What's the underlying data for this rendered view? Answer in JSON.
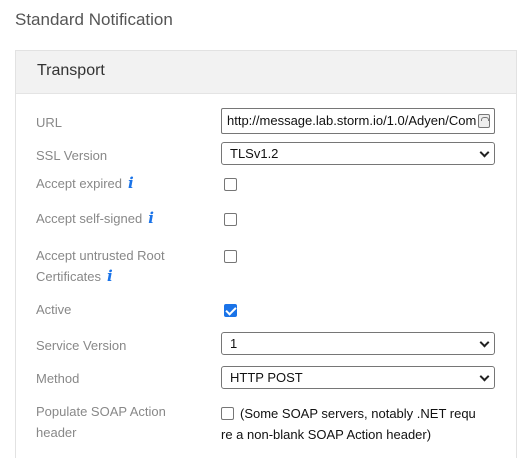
{
  "page_title": "Standard Notification",
  "panel": {
    "title": "Transport"
  },
  "fields": {
    "url": {
      "label": "URL",
      "value": "http://message.lab.storm.io/1.0/Adyen/Com"
    },
    "ssl_version": {
      "label": "SSL Version",
      "value": "TLSv1.2"
    },
    "accept_expired": {
      "label": "Accept expired",
      "checked": false
    },
    "accept_self_signed": {
      "label": "Accept self-signed",
      "checked": false
    },
    "accept_untrusted_root": {
      "label_line1": "Accept untrusted Root",
      "label_line2": "Certificates",
      "checked": false
    },
    "active": {
      "label": "Active",
      "checked": true
    },
    "service_version": {
      "label": "Service Version",
      "value": "1"
    },
    "method": {
      "label": "Method",
      "value": "HTTP POST"
    },
    "populate_soap": {
      "label_line1": "Populate SOAP Action",
      "label_line2": "header",
      "checked": false,
      "note_line1": "(Some SOAP servers, notably .NET requ",
      "note_line2": "re a non-blank SOAP Action header)"
    }
  },
  "icons": {
    "info": "i"
  },
  "colors": {
    "accent": "#1a73e8",
    "header_bg": "#f2f2f2",
    "label": "#888888"
  }
}
